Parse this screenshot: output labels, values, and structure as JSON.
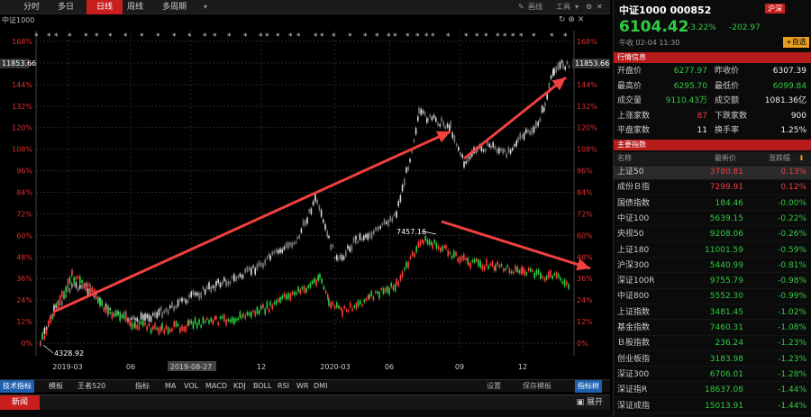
{
  "toolbar": {
    "tabs": [
      "分时",
      "多日",
      "日线",
      "周线",
      "多周期"
    ],
    "active": "日线",
    "right": [
      "画线",
      "工具"
    ]
  },
  "chart": {
    "label": "中证1000",
    "current_price_tag": "11853.66",
    "high_label": "7457.16",
    "low_label": "4328.92",
    "pct_ticks": [
      "168%",
      "156%",
      "144%",
      "132%",
      "120%",
      "108%",
      "96%",
      "84%",
      "72%",
      "60%",
      "48%",
      "36%",
      "24%",
      "12%",
      "0%"
    ],
    "x_ticks": [
      "2019-03",
      "06",
      "2019-08-27",
      "12",
      "2020-03",
      "06",
      "09",
      "12"
    ]
  },
  "indicators": {
    "tech": "技术指标",
    "items": [
      "模板",
      "王者520",
      "指标",
      "MA",
      "VOL",
      "MACD",
      "KDJ",
      "BOLL",
      "RSI",
      "WR",
      "DMI"
    ],
    "buttons": [
      "设置",
      "保存模板",
      "指标树"
    ]
  },
  "news": {
    "tab": "新闻",
    "expand": "展开"
  },
  "panel": {
    "title": "中证1000 000852",
    "badge": "沪深",
    "price": "6104.42",
    "change_pct": "-3.22%",
    "change": "-202.97",
    "time": "午收  02-04  11:30",
    "add": "+自选",
    "quote_header": "行情信息",
    "quotes": [
      {
        "l1": "开盘价",
        "v1": "6277.97",
        "c1": "green",
        "l2": "昨收价",
        "v2": "6307.39",
        "c2": "white"
      },
      {
        "l1": "最高价",
        "v1": "6295.70",
        "c1": "green",
        "l2": "最低价",
        "v2": "6099.84",
        "c2": "green"
      },
      {
        "l1": "成交量",
        "v1": "9110.43万",
        "c1": "green",
        "l2": "成交额",
        "v2": "1081.36亿",
        "c2": "white"
      },
      {
        "l1": "上涨家数",
        "v1": "87",
        "c1": "red",
        "l2": "下跌家数",
        "v2": "900",
        "c2": "white"
      },
      {
        "l1": "平盘家数",
        "v1": "11",
        "c1": "white",
        "l2": "换手率",
        "v2": "1.25%",
        "c2": "white"
      }
    ],
    "index_header": "主要指数",
    "table_head": [
      "名称",
      "最新价",
      "涨跌幅"
    ],
    "indexes": [
      {
        "name": "上证50",
        "price": "3780.81",
        "pct": "0.13%",
        "up": true
      },
      {
        "name": "成份Ｂ指",
        "price": "7299.91",
        "pct": "0.12%",
        "up": true
      },
      {
        "name": "国债指数",
        "price": "184.46",
        "pct": "-0.00%",
        "up": false
      },
      {
        "name": "中证100",
        "price": "5639.15",
        "pct": "-0.22%",
        "up": false
      },
      {
        "name": "央视50",
        "price": "9208.06",
        "pct": "-0.26%",
        "up": false
      },
      {
        "name": "上证180",
        "price": "11001.59",
        "pct": "-0.59%",
        "up": false
      },
      {
        "name": "沪深300",
        "price": "5440.99",
        "pct": "-0.81%",
        "up": false
      },
      {
        "name": "深证100R",
        "price": "9755.79",
        "pct": "-0.98%",
        "up": false
      },
      {
        "name": "中证800",
        "price": "5552.30",
        "pct": "-0.99%",
        "up": false
      },
      {
        "name": "上证指数",
        "price": "3481.45",
        "pct": "-1.02%",
        "up": false
      },
      {
        "name": "基金指数",
        "price": "7460.31",
        "pct": "-1.08%",
        "up": false
      },
      {
        "name": "Ｂ股指数",
        "price": "236.24",
        "pct": "-1.23%",
        "up": false
      },
      {
        "name": "创业板指",
        "price": "3183.98",
        "pct": "-1.23%",
        "up": false
      },
      {
        "name": "深证300",
        "price": "6706.01",
        "pct": "-1.28%",
        "up": false
      },
      {
        "name": "深证指R",
        "price": "18637.08",
        "pct": "-1.44%",
        "up": false
      },
      {
        "name": "深证成指",
        "price": "15013.91",
        "pct": "-1.44%",
        "up": false
      }
    ]
  }
}
